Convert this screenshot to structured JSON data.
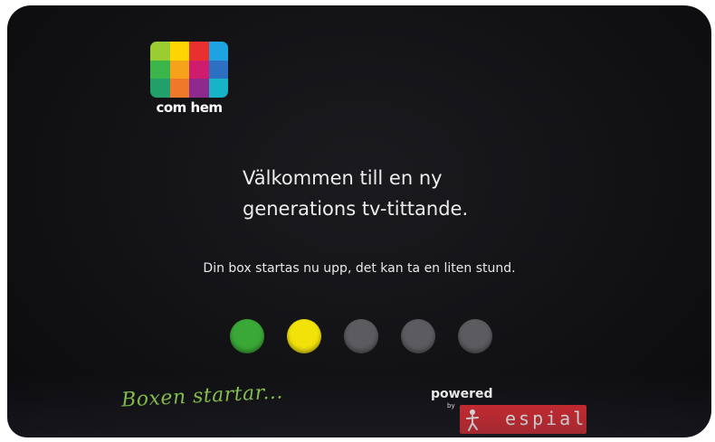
{
  "logo": {
    "wordmark": "com hem",
    "tiles": [
      "#9acd32",
      "#ffd400",
      "#e8312f",
      "#1fa3e0",
      "#3bb54a",
      "#f7a21b",
      "#d01c6e",
      "#2d6fc0",
      "#23a06a",
      "#f0782a",
      "#8e2a8e",
      "#17b4c8"
    ]
  },
  "welcome": {
    "line1": "Välkommen till en ny",
    "line2": "generations tv-tittande."
  },
  "message": "Din box startas nu upp, det kan ta en liten stund.",
  "progress": {
    "total_steps": 5,
    "completed_steps": 2,
    "colors": [
      "#3aa836",
      "#f2e20a",
      "#5c5c60",
      "#5c5c60",
      "#5c5c60"
    ]
  },
  "status_caption": "Boxen startar...",
  "powered_by": {
    "powered": "powered",
    "by": "by",
    "brand": "espial",
    "brand_color": "#e02a2e"
  }
}
